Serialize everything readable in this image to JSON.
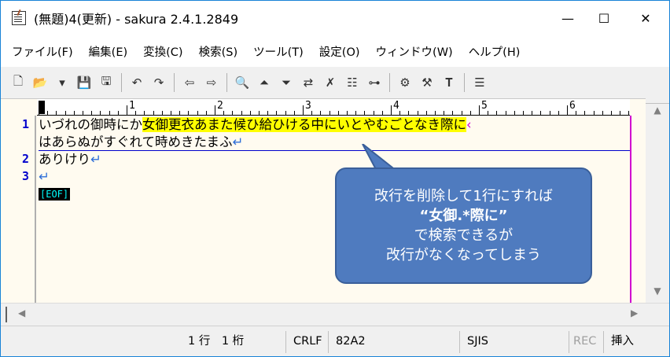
{
  "window": {
    "title": "(無題)4(更新) - sakura 2.4.1.2849",
    "controls": {
      "minimize": "—",
      "maximize": "☐",
      "close": "✕"
    }
  },
  "menu": {
    "items": [
      {
        "label": "ファイル(F)"
      },
      {
        "label": "編集(E)"
      },
      {
        "label": "変換(C)"
      },
      {
        "label": "検索(S)"
      },
      {
        "label": "ツール(T)"
      },
      {
        "label": "設定(O)"
      },
      {
        "label": "ウィンドウ(W)"
      },
      {
        "label": "ヘルプ(H)"
      }
    ]
  },
  "toolbar": {
    "groups": [
      [
        "new-file-icon",
        "open-folder-icon",
        "dropdown-arrow-icon",
        "save-icon",
        "save-all-icon"
      ],
      [
        "undo-icon",
        "redo-icon"
      ],
      [
        "jump-back-icon",
        "jump-forward-icon"
      ],
      [
        "search-icon",
        "search-prev-icon",
        "search-next-icon",
        "replace-icon",
        "search-clear-icon",
        "grep-icon",
        "outline-icon"
      ],
      [
        "settings-icon",
        "type-settings-icon",
        "font-settings-icon"
      ],
      [
        "window-list-icon"
      ]
    ],
    "glyphs": {
      "new-file-icon": "🗋",
      "open-folder-icon": "📂",
      "dropdown-arrow-icon": "▾",
      "save-icon": "💾",
      "save-all-icon": "🖫",
      "undo-icon": "↶",
      "redo-icon": "↷",
      "jump-back-icon": "⇦",
      "jump-forward-icon": "⇨",
      "search-icon": "🔍",
      "search-prev-icon": "⏶",
      "search-next-icon": "⏷",
      "replace-icon": "⇄",
      "search-clear-icon": "✗",
      "grep-icon": "☷",
      "outline-icon": "⊶",
      "settings-icon": "⚙",
      "type-settings-icon": "⚒",
      "font-settings-icon": "𝐓",
      "window-list-icon": "☰"
    }
  },
  "ruler": {
    "labels": [
      "1",
      "2",
      "3",
      "4",
      "5",
      "6"
    ]
  },
  "editor": {
    "line_numbers": [
      "1",
      "2",
      "3"
    ],
    "line1_plain": "いづれの御時にか",
    "line1_highlight": "女御更衣あまた候ひ給ひける中にいとやむごとなき際に",
    "line1_wrapmark": "‹",
    "line1_cont": "はあらぬがすぐれて時めきたまふ",
    "line2": "ありけり",
    "crlf_mark": "↵",
    "eof": "[EOF]"
  },
  "status": {
    "position": "1 行　1 桁",
    "newline": "CRLF",
    "char_code": "82A2",
    "encoding": "SJIS",
    "rec": "REC",
    "mode": "挿入"
  },
  "callout": {
    "line1": "改行を削除して1行にすれば",
    "line2": "“女御.*際に”",
    "line3": "で検索できるが",
    "line4": "改行がなくなってしまう"
  },
  "colors": {
    "highlight": "#ffff00",
    "line_number": "#0000cc",
    "wrap_guide": "#d000d0",
    "callout_bg": "#4f7bbf",
    "editor_bg": "#fffbf0"
  }
}
